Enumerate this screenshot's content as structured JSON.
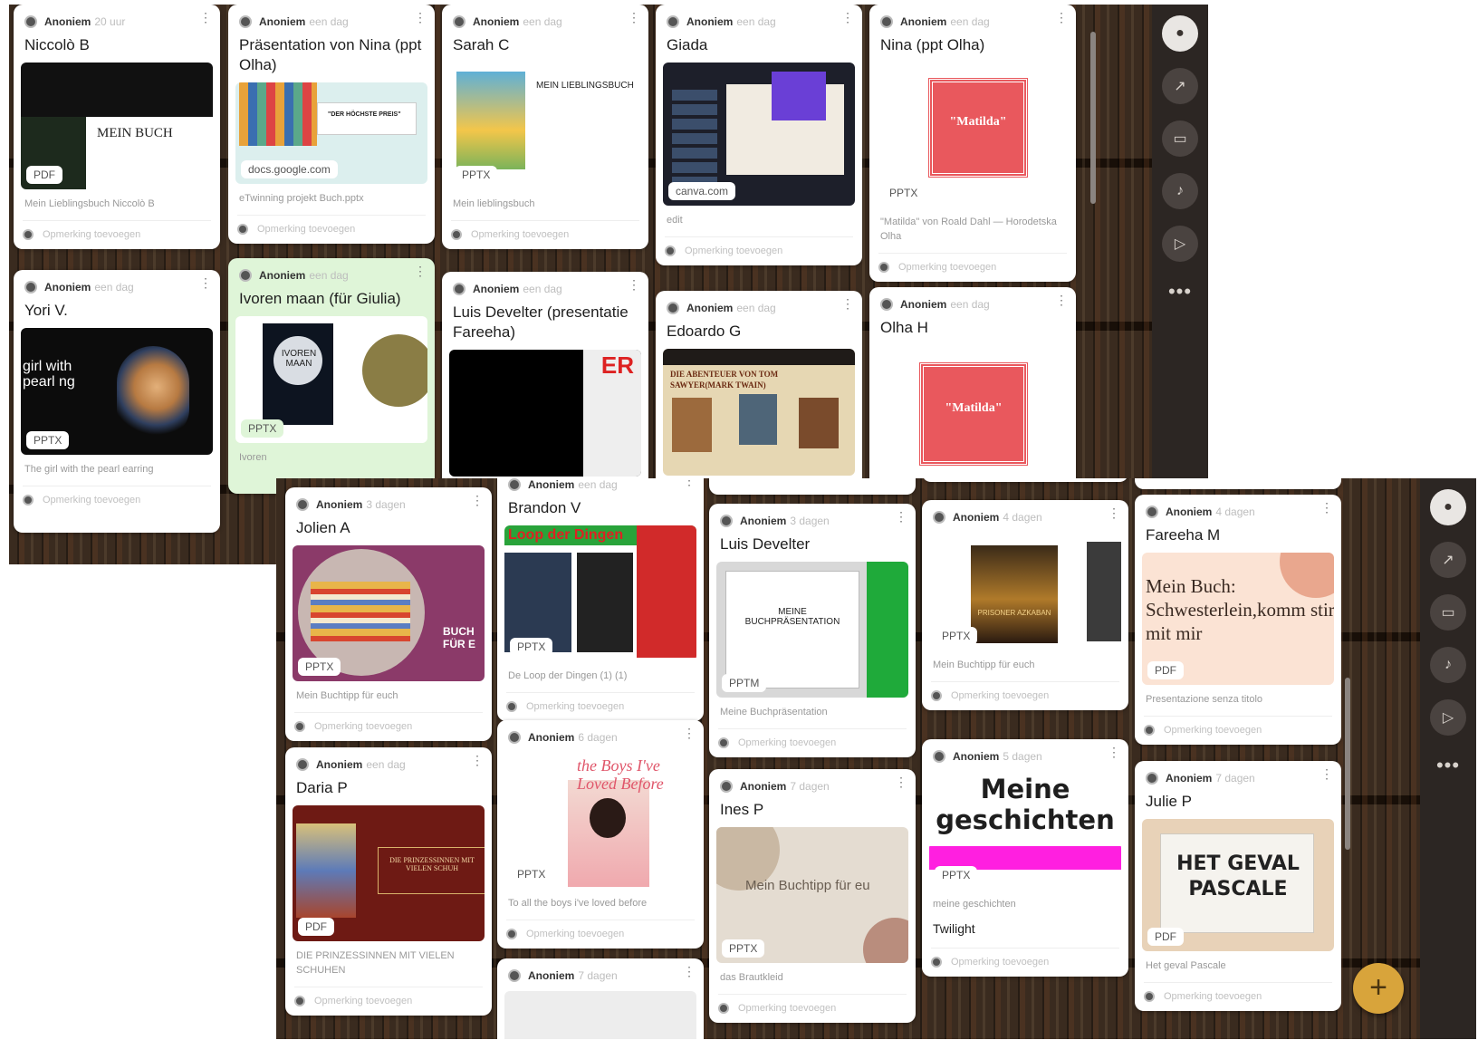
{
  "comment_placeholder": "Opmerking toevoegen",
  "panel_a": {
    "cards": [
      {
        "author": "Anoniem",
        "age": "20 uur",
        "title": "Niccolò B",
        "type": "PDF",
        "caption": "Mein Lieblingsbuch Niccolò B",
        "slide": "MEIN BUCH"
      },
      {
        "author": "Anoniem",
        "age": "een dag",
        "title": "Präsentation von Nina (ppt Olha)",
        "domain": "docs.google.com",
        "caption": "eTwinning projekt Buch.pptx",
        "slide": "\"DER HÖCHSTE PREIS\""
      },
      {
        "author": "Anoniem",
        "age": "een dag",
        "title": "Sarah C",
        "type": "PPTX",
        "caption": "Mein lieblingsbuch",
        "slide": "MEIN LIEBLINGSBUCH"
      },
      {
        "author": "Anoniem",
        "age": "een dag",
        "title": "Giada",
        "domain": "canva.com",
        "caption": "edit"
      },
      {
        "author": "Anoniem",
        "age": "een dag",
        "title": "Nina (ppt Olha)",
        "type": "PPTX",
        "caption": "\"Matilda\" von Roald Dahl — Horodetska Olha",
        "slide": "\"Matilda\""
      },
      {
        "author": "Anoniem",
        "age": "een dag",
        "title": "Yori V.",
        "type": "PPTX",
        "caption": "The girl with the pearl earring",
        "slide": "girl with pearl ng"
      },
      {
        "author": "Anoniem",
        "age": "een dag",
        "title": "Ivoren maan (für Giulia)",
        "type": "PPTX",
        "caption": "Ivoren",
        "slide": "IVOREN MAAN"
      },
      {
        "author": "Anoniem",
        "age": "een dag",
        "title": "Luis Develter (presentatie Fareeha)",
        "slide": "ER"
      },
      {
        "author": "Anoniem",
        "age": "een dag",
        "title": "Edoardo G",
        "slide": "DIE ABENTEUER VON TOM SAWYER(MARK TWAIN)"
      },
      {
        "author": "Anoniem",
        "age": "een dag",
        "title": "Olha H",
        "slide": "\"Matilda\""
      }
    ]
  },
  "panel_b": {
    "cards": [
      {
        "author": "Anoniem",
        "age": "3 dagen",
        "title": "Jolien A",
        "type": "PPTX",
        "caption": "Mein Buchtipp für euch",
        "slide": "BUCH FÜR E"
      },
      {
        "author": "Anoniem",
        "age": "een dag",
        "title": "Daria P",
        "type": "PDF",
        "caption": "DIE PRINZESSINNEN MIT VIELEN SCHUHEN",
        "slide": "DIE PRINZESSINNEN MIT VIELEN SCHUH"
      },
      {
        "author": "Anoniem",
        "age": "een dag",
        "title": "Brandon V",
        "type": "PPTX",
        "caption": "De Loop der Dingen (1) (1)",
        "slide": "Loop der Dingen"
      },
      {
        "author": "Anoniem",
        "age": "6 dagen",
        "type": "PPTX",
        "caption": "To all the boys i've loved before",
        "slide": "the Boys I've Loved Before"
      },
      {
        "author": "Anoniem",
        "age": "7 dagen"
      },
      {
        "author": "Anoniem",
        "age": "3 dagen",
        "title": "Luis Develter",
        "type": "PPTM",
        "caption": "Meine Buchpräsentation",
        "slide": "MEINE BUCHPRÄSENTATION"
      },
      {
        "author": "Anoniem",
        "age": "7 dagen",
        "title": "Ines P",
        "type": "PPTX",
        "caption": "das Brautkleid",
        "slide": "Mein Buchtipp für eu"
      },
      {
        "author": "Anoniem",
        "age": "4 dagen",
        "type": "PPTX",
        "caption": "Mein Buchtipp für euch",
        "slide": "PRISONER AZKABAN"
      },
      {
        "author": "Anoniem",
        "age": "5 dagen",
        "title": "Meine geschichten",
        "type": "PPTX",
        "caption": "meine geschichten",
        "extra": "Twilight"
      },
      {
        "author": "Anoniem",
        "age": "4 dagen",
        "title": "Fareeha M",
        "type": "PDF",
        "caption": "Presentazione senza titolo",
        "slide": "Mein Buch: Schwesterlein,komm stirb mit mir"
      },
      {
        "author": "Anoniem",
        "age": "7 dagen",
        "title": "Julie P",
        "type": "PDF",
        "caption": "Het geval Pascale",
        "slide": "HET GEVAL PASCALE"
      }
    ]
  }
}
